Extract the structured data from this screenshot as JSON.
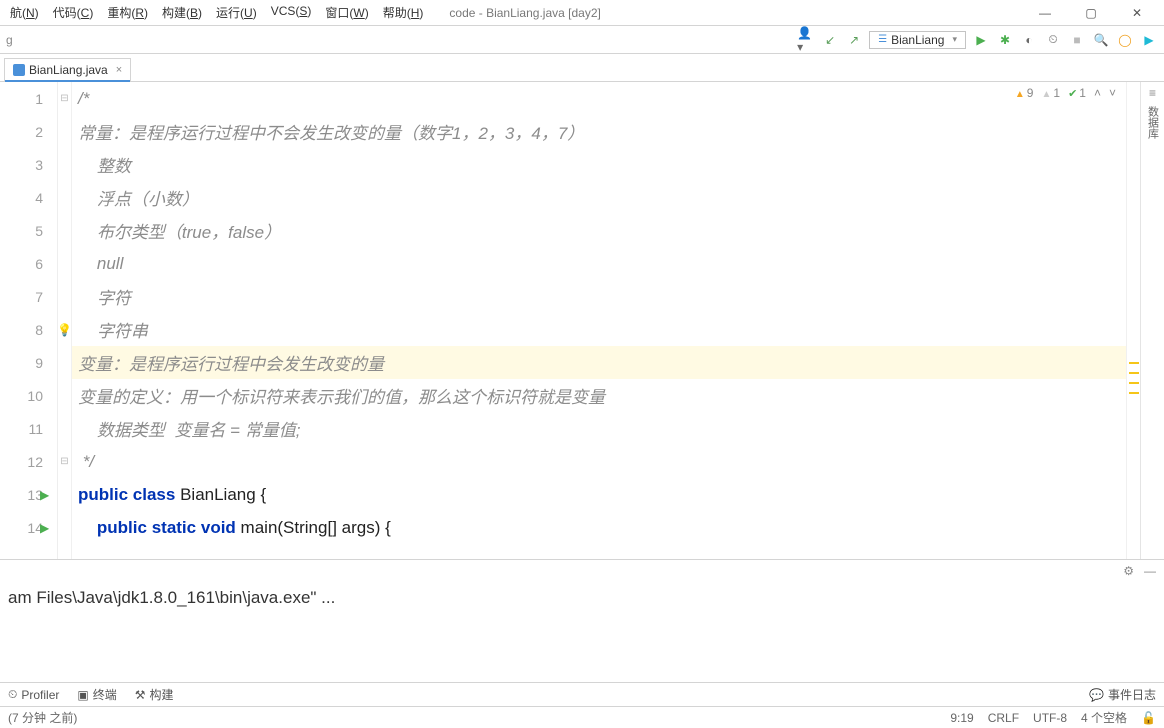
{
  "menu": {
    "items": [
      {
        "label": "航",
        "key": "N"
      },
      {
        "label": "代码",
        "key": "C"
      },
      {
        "label": "重构",
        "key": "R"
      },
      {
        "label": "构建",
        "key": "B"
      },
      {
        "label": "运行",
        "key": "U"
      },
      {
        "label": "VCS",
        "key": "S"
      },
      {
        "label": "窗口",
        "key": "W"
      },
      {
        "label": "帮助",
        "key": "H"
      }
    ],
    "title": "code - BianLiang.java [day2]"
  },
  "toolbar": {
    "run_config": "BianLiang"
  },
  "tab": {
    "file": "BianLiang.java"
  },
  "gutter": {
    "lines": [
      "1",
      "2",
      "3",
      "4",
      "5",
      "6",
      "7",
      "8",
      "9",
      "10",
      "11",
      "12",
      "13",
      "14"
    ]
  },
  "code": {
    "l1": "/*",
    "l2": "常量：是程序运行过程中不会发生改变的量（数字1，2，3，4，7）",
    "l3": "    整数",
    "l4": "    浮点（小数）",
    "l5": "    布尔类型（true，false）",
    "l6": "    null",
    "l7": "    字符",
    "l8": "    字符串",
    "l9": "变量：是程序运行过程中会发生改变的量",
    "l10": "变量的定义：用一个标识符来表示我们的值，那么这个标识符就是变量",
    "l11": "    数据类型  变量名 = 常量值;",
    "l12": " */",
    "l13_kw1": "public",
    "l13_kw2": "class",
    "l13_name": "BianLiang",
    "l13_brace": "{",
    "l14_kw1": "public",
    "l14_kw2": "static",
    "l14_kw3": "void",
    "l14_sig": "main(String[] args) {"
  },
  "inspections": {
    "warn": "9",
    "info": "1",
    "ok": "1"
  },
  "sidetool": {
    "db": "数据库"
  },
  "console": {
    "output": "am Files\\Java\\jdk1.8.0_161\\bin\\java.exe\" ..."
  },
  "bottom": {
    "profiler": "Profiler",
    "terminal": "终端",
    "build": "构建",
    "eventlog": "事件日志"
  },
  "status": {
    "left": "(7 分钟 之前)",
    "pos": "9:19",
    "eol": "CRLF",
    "enc": "UTF-8",
    "indent": "4 个空格"
  }
}
